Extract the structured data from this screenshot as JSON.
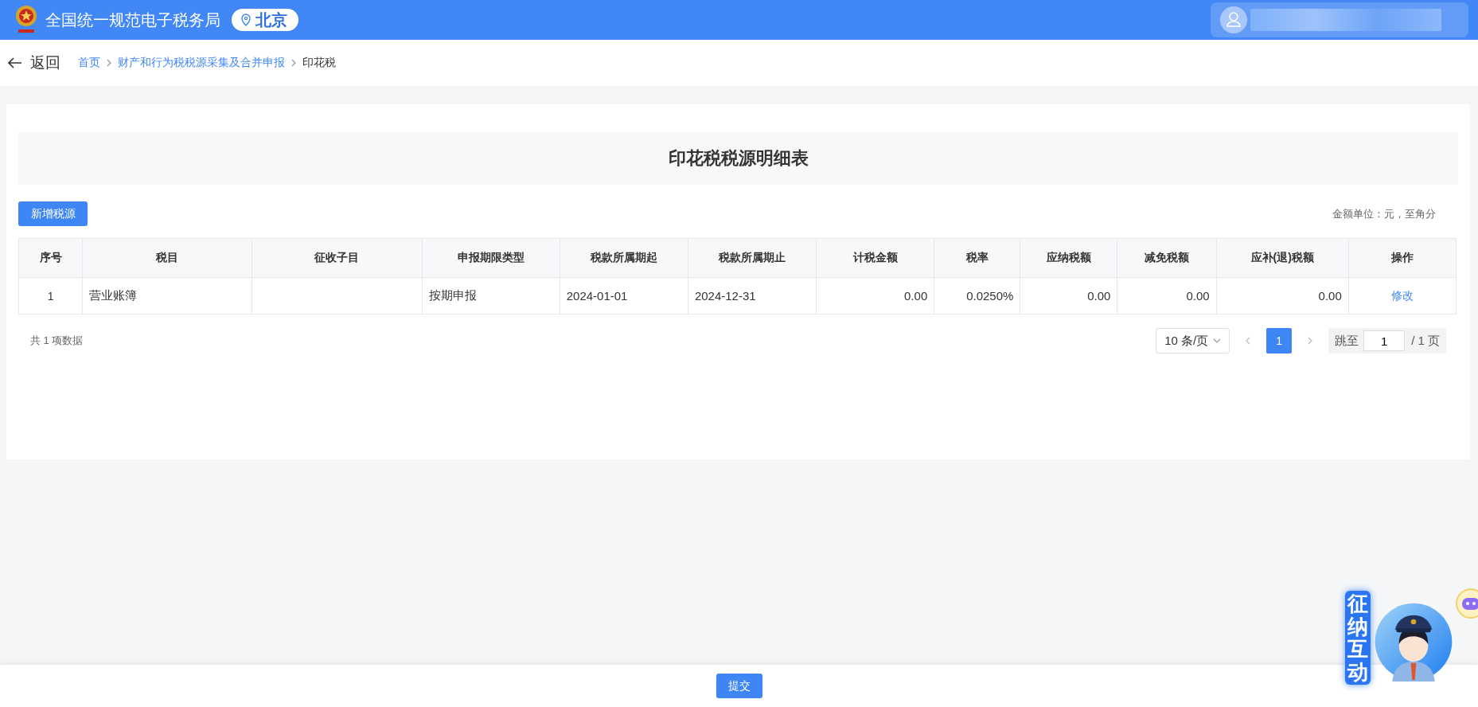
{
  "header": {
    "title": "全国统一规范电子税务局",
    "location": "北京"
  },
  "nav": {
    "back_label": "返回",
    "breadcrumb": [
      {
        "label": "首页",
        "current": false
      },
      {
        "label": "财产和行为税税源采集及合并申报",
        "current": false
      },
      {
        "label": "印花税",
        "current": true
      }
    ]
  },
  "page_title": "印花税税源明细表",
  "add_button": "新增税源",
  "unit_note": "金额单位：元，至角分",
  "table": {
    "columns": [
      "序号",
      "税目",
      "征收子目",
      "申报期限类型",
      "税款所属期起",
      "税款所属期止",
      "计税金额",
      "税率",
      "应纳税额",
      "减免税额",
      "应补(退)税额",
      "操作"
    ],
    "rows": [
      {
        "cells": [
          "1",
          "营业账簿",
          "",
          "按期申报",
          "2024-01-01",
          "2024-12-31",
          "0.00",
          "0.0250%",
          "0.00",
          "0.00",
          "0.00"
        ],
        "action": "修改"
      }
    ]
  },
  "pagination": {
    "total_text": "共 1 项数据",
    "page_size": "10 条/页",
    "pages": [
      {
        "label": "1",
        "selected": true
      }
    ],
    "jump_label": "跳至",
    "jump_value": "1",
    "page_total": "/ 1 页"
  },
  "assistant": {
    "label": "征纳互动"
  },
  "submit_button": "提交"
}
